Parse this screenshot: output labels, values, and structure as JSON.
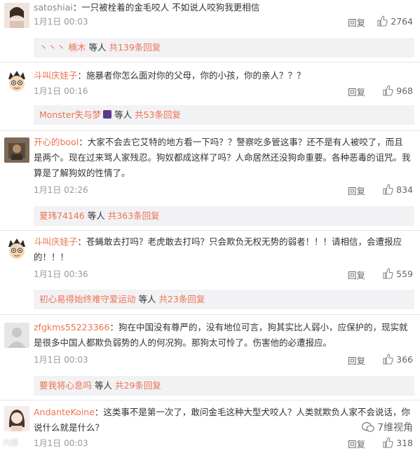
{
  "comments": [
    {
      "username": "satoshiai",
      "text": "：一只被栓着的金毛咬人 不如说人咬狗我更相信",
      "time": "1月1日 00:03",
      "reply_label": "回复",
      "likes": "2764",
      "sub": {
        "names": "丶丶丶 楠木",
        "mid": " 等人 ",
        "count": "共139条回复"
      }
    },
    {
      "username": "斗叫庆娃子",
      "text": "：施暴者你怎么面对你的父母，你的小孩，你的亲人？？？",
      "time": "1月1日 00:16",
      "reply_label": "回复",
      "likes": "968",
      "sub": {
        "names": "Monster失与梦",
        "mid": " 等人 ",
        "count": "共53条回复"
      }
    },
    {
      "username": "开心的bool",
      "text": "：大家不会去它艾特的地方看一下吗？？警察吃多管这事？还不是有人被咬了，而且是两个。现在过来骂人家残忍。狗奴都成这样了吗？人命居然还没狗命重要。各种恶毒的诅咒。我算是了解狗奴的性情了。",
      "time": "1月1日 02:26",
      "reply_label": "回复",
      "likes": "834",
      "sub": {
        "names": "夏玮74146",
        "mid": " 等人 ",
        "count": "共363条回复"
      }
    },
    {
      "username": "斗叫庆娃子",
      "text": "：苍蝇敢去打吗？老虎敢去打吗？只会欺负无权无势的弱者！！！请相信，会遭报应的！！！",
      "time": "1月1日 00:36",
      "reply_label": "回复",
      "likes": "559",
      "sub": {
        "names": "初心易得始终难守爱运动",
        "mid": " 等人 ",
        "count": "共23条回复"
      }
    },
    {
      "username": "zfgkms55223366",
      "text": "：狗在中国没有尊严的，没有地位可言，狗其实比人弱小，应保护的，现实就是很多中国人都欺负弱势的人的何况狗。那狗太可怜了。伤害他的必遭报应。",
      "time": "1月1日 00:03",
      "reply_label": "回复",
      "likes": "366",
      "sub": {
        "names": "要我将心息吗",
        "mid": " 等人 ",
        "count": "共29条回复"
      }
    },
    {
      "username": "AndanteKoine",
      "text": "：这类事不是第一次了，敢问金毛这种大型犬咬人？人类就欺负人家不会说话，你说什么就是什么？",
      "time": "1月1日 00:03",
      "reply_label": "回复",
      "likes": "318"
    }
  ],
  "watermark_right": "7维视角",
  "watermark_left": "六郎"
}
